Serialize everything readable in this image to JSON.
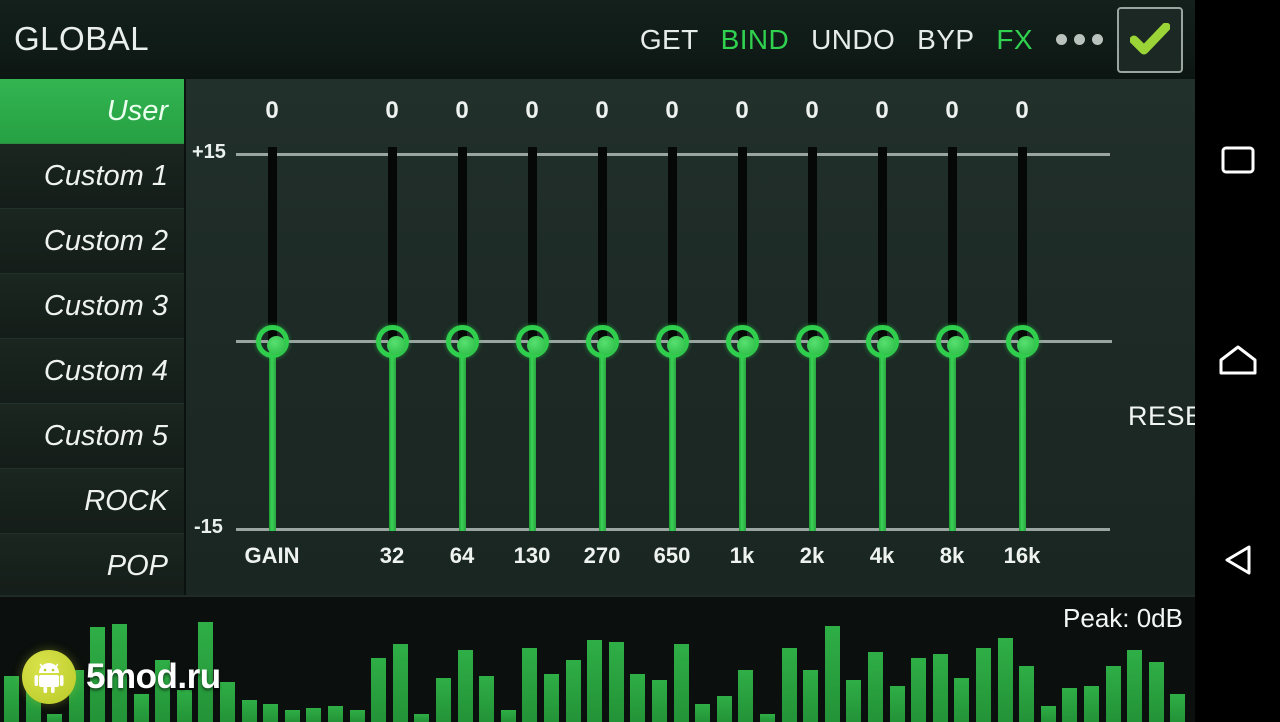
{
  "header": {
    "title": "GLOBAL",
    "actions": [
      {
        "label": "GET",
        "active": false
      },
      {
        "label": "BIND",
        "active": true
      },
      {
        "label": "UNDO",
        "active": false
      },
      {
        "label": "BYP",
        "active": false
      },
      {
        "label": "FX",
        "active": true
      }
    ],
    "overflow_icon": "more-options-icon",
    "confirm_icon": "checkmark-icon"
  },
  "sidebar": {
    "items": [
      {
        "label": "User",
        "selected": true
      },
      {
        "label": "Custom 1",
        "selected": false
      },
      {
        "label": "Custom 2",
        "selected": false
      },
      {
        "label": "Custom 3",
        "selected": false
      },
      {
        "label": "Custom 4",
        "selected": false
      },
      {
        "label": "Custom 5",
        "selected": false
      },
      {
        "label": "ROCK",
        "selected": false
      },
      {
        "label": "POP",
        "selected": false
      }
    ]
  },
  "equalizer": {
    "top_label": "+15",
    "bottom_label": "-15",
    "reset_label": "RESET",
    "bands": [
      {
        "freq": "GAIN",
        "value": "0"
      },
      {
        "freq": "32",
        "value": "0"
      },
      {
        "freq": "64",
        "value": "0"
      },
      {
        "freq": "130",
        "value": "0"
      },
      {
        "freq": "270",
        "value": "0"
      },
      {
        "freq": "650",
        "value": "0"
      },
      {
        "freq": "1k",
        "value": "0"
      },
      {
        "freq": "2k",
        "value": "0"
      },
      {
        "freq": "4k",
        "value": "0"
      },
      {
        "freq": "8k",
        "value": "0"
      },
      {
        "freq": "16k",
        "value": "0"
      }
    ]
  },
  "spectrum": {
    "peak_label": "Peak: 0dB",
    "bar_heights": [
      46,
      38,
      8,
      52,
      95,
      98,
      28,
      62,
      32,
      100,
      40,
      22,
      18,
      12,
      14,
      16,
      12,
      64,
      78,
      8,
      44,
      72,
      46,
      12,
      74,
      48,
      62,
      82,
      80,
      48,
      42,
      78,
      18,
      26,
      52,
      8,
      74,
      52,
      96,
      42,
      70,
      36,
      64,
      68,
      44,
      74,
      84,
      56,
      16,
      34,
      36,
      56,
      72,
      60,
      28
    ]
  },
  "watermark": {
    "text": "5mod.ru",
    "icon": "android-robot-icon"
  },
  "navbar": {
    "buttons": [
      {
        "icon": "recents-square-icon"
      },
      {
        "icon": "home-icon"
      },
      {
        "icon": "back-triangle-icon"
      }
    ]
  },
  "colors": {
    "accent_green": "#2fd14f",
    "selected_green": "#2cae48",
    "panel_bg": "#1d2a26",
    "header_bg": "#101b17",
    "check_green": "#9ad436"
  }
}
